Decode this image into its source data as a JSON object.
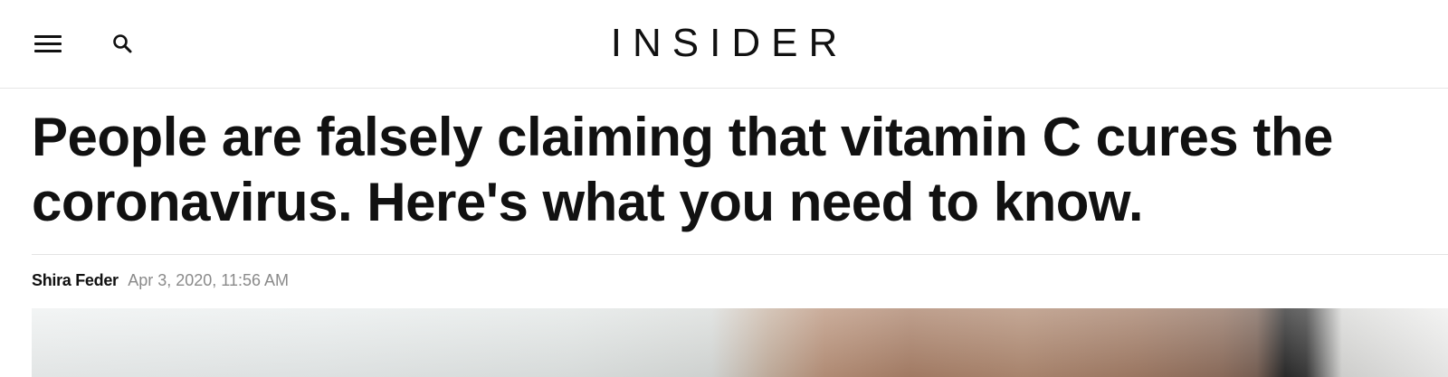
{
  "header": {
    "logo_text": "INSIDER",
    "menu_icon": "hamburger-menu-icon",
    "search_icon": "search-icon"
  },
  "article": {
    "headline": "People are falsely claiming that vitamin C cures the coronavirus. Here's what you need to know.",
    "author": "Shira Feder",
    "date": "Apr 3, 2020, 11:56 AM"
  },
  "colors": {
    "text": "#111111",
    "date_gray": "#8a8a8a",
    "divider": "#e3e3e3"
  }
}
